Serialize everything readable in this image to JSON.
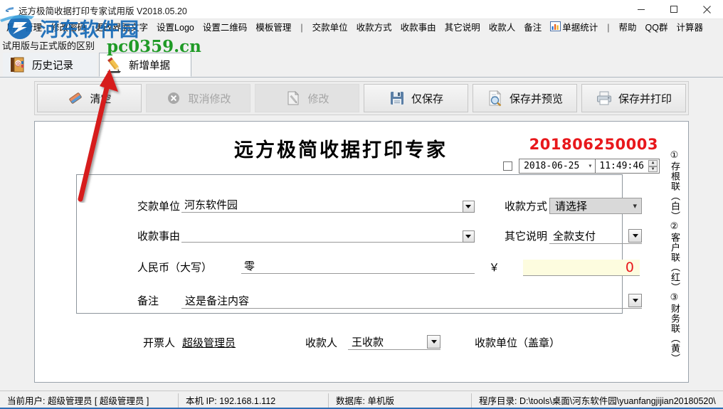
{
  "window": {
    "title": "远方极简收据打印专家试用版 V2018.05.20",
    "minimize": "minimize-icon",
    "maximize": "maximize-icon",
    "close": "close-icon"
  },
  "menu": {
    "items": [
      {
        "label": "用户管理",
        "icon": ""
      },
      {
        "label": "修改密码",
        "icon": ""
      },
      {
        "label": "更改界面文字",
        "icon": ""
      },
      {
        "label": "设置Logo",
        "icon": ""
      },
      {
        "label": "设置二维码",
        "icon": ""
      },
      {
        "label": "模板管理",
        "icon": ""
      },
      {
        "label": "|",
        "icon": "separator"
      },
      {
        "label": "交款单位",
        "icon": ""
      },
      {
        "label": "收款方式",
        "icon": ""
      },
      {
        "label": "收款事由",
        "icon": ""
      },
      {
        "label": "其它说明",
        "icon": ""
      },
      {
        "label": "收款人",
        "icon": ""
      },
      {
        "label": "备注",
        "icon": ""
      },
      {
        "label": "单据统计",
        "icon": "chart-bar-icon"
      },
      {
        "label": "|",
        "icon": "separator"
      },
      {
        "label": "帮助",
        "icon": ""
      },
      {
        "label": "QQ群",
        "icon": ""
      },
      {
        "label": "计算器",
        "icon": ""
      }
    ]
  },
  "watermark": {
    "brand": "河东软件园",
    "domain": "pc0359.cn",
    "trial_note": "试用版与正式版的区别",
    "brand_color": "#1469b7",
    "domain_color": "#1f9a26"
  },
  "tabs": [
    {
      "label": "历史记录",
      "icon": "book-icon",
      "active": false
    },
    {
      "label": "新增单据",
      "icon": "pencil-icon",
      "active": true
    }
  ],
  "toolbar": {
    "buttons": [
      {
        "label": "清空",
        "icon": "eraser-icon",
        "enabled": true
      },
      {
        "label": "取消修改",
        "icon": "cancel-circle-icon",
        "enabled": false
      },
      {
        "label": "修改",
        "icon": "edit-page-icon",
        "enabled": false
      },
      {
        "label": "仅保存",
        "icon": "floppy-disk-icon",
        "enabled": true
      },
      {
        "label": "保存并预览",
        "icon": "preview-magnifier-icon",
        "enabled": true
      },
      {
        "label": "保存并打印",
        "icon": "printer-icon",
        "enabled": true
      }
    ]
  },
  "receipt": {
    "title": "远方极简收据打印专家",
    "number": "201806250003",
    "number_color": "#e8171b",
    "date_checkbox_checked": false,
    "date": "2018-06-25",
    "time": "11:49:46",
    "fields": {
      "payer_label": "交款单位",
      "payer_value": "河东软件园",
      "reason_label": "收款事由",
      "reason_value": "",
      "amount_cn_label": "人民币（大写）",
      "amount_cn_value": "零",
      "currency_symbol": "￥",
      "amount_value": "0",
      "remark_label": "备注",
      "remark_value": "这是备注内容",
      "pay_method_label": "收款方式",
      "pay_method_value": "请选择",
      "other_note_label": "其它说明",
      "other_note_value": "全款支付"
    },
    "side_text": "①存根联（白）②客户联（红）③财务联（黄）",
    "signatures": {
      "issuer_label": "开票人",
      "issuer_value": "超级管理员",
      "payee_label": "收款人",
      "payee_value": "王收款",
      "stamp_label": "收款单位（盖章）"
    }
  },
  "statusbar": {
    "user": "当前用户: 超级管理员 [ 超级管理员 ]",
    "ip": "本机 IP: 192.168.1.112",
    "database": "数据库: 单机版",
    "program_dir": "程序目录: D:\\tools\\桌面\\河东软件园\\yuanfangjijian20180520\\"
  }
}
